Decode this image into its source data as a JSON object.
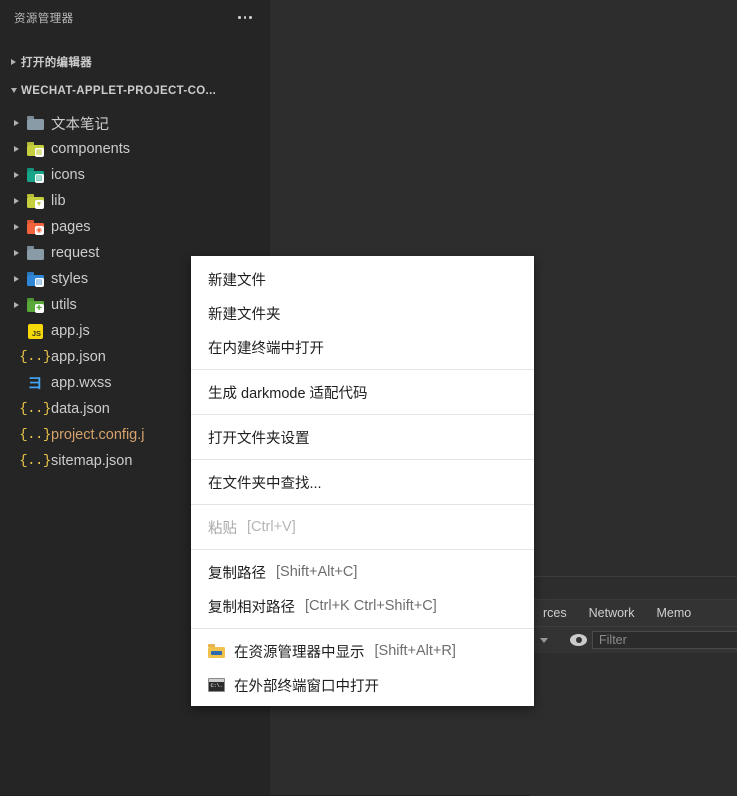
{
  "colors": {
    "sidebar_bg": "#252526",
    "editor_bg": "#2d2d2d",
    "menu_bg": "#ffffff",
    "text": "#cccccc",
    "modified_file": "#d5a26a"
  },
  "sidebar": {
    "title": "资源管理器",
    "more_label": "...",
    "sections": [
      {
        "label": "打开的编辑器",
        "expanded": false
      },
      {
        "label": "WECHAT-APPLET-PROJECT-CO...",
        "expanded": true
      }
    ],
    "tree": [
      {
        "label": "文本笔记",
        "type": "folder",
        "icon": "folder-gray-icon",
        "color": "#8a9ba8",
        "tabcolor": "#7a8a96",
        "glyph": "",
        "glyphbg": "",
        "expandable": true,
        "modified": false
      },
      {
        "label": "components",
        "type": "folder",
        "icon": "folder-components-icon",
        "color": "#c6cf3e",
        "tabcolor": "#b4bc38",
        "glyph": "▦",
        "glyphbg": "#ffffff",
        "expandable": true,
        "modified": false
      },
      {
        "label": "icons",
        "type": "folder",
        "icon": "folder-images-icon",
        "color": "#17a589",
        "tabcolor": "#13907a",
        "glyph": "▧",
        "glyphbg": "#ffffff",
        "expandable": true,
        "modified": false
      },
      {
        "label": "lib",
        "type": "folder",
        "icon": "folder-lib-icon",
        "color": "#c6cf3e",
        "tabcolor": "#b4bc38",
        "glyph": "▼",
        "glyphbg": "#ffffff",
        "expandable": true,
        "modified": false
      },
      {
        "label": "pages",
        "type": "folder",
        "icon": "folder-pages-icon",
        "color": "#f2643d",
        "tabcolor": "#dd5632",
        "glyph": "◉",
        "glyphbg": "#ffffff",
        "expandable": true,
        "modified": false
      },
      {
        "label": "request",
        "type": "folder",
        "icon": "folder-gray-icon",
        "color": "#8a9ba8",
        "tabcolor": "#7a8a96",
        "glyph": "",
        "glyphbg": "",
        "expandable": true,
        "modified": false
      },
      {
        "label": "styles",
        "type": "folder",
        "icon": "folder-css-icon",
        "color": "#2f86d6",
        "tabcolor": "#2a78c0",
        "glyph": "▤",
        "glyphbg": "#ffffff",
        "expandable": true,
        "modified": false
      },
      {
        "label": "utils",
        "type": "folder",
        "icon": "folder-tools-icon",
        "color": "#5aa83a",
        "tabcolor": "#4e9531",
        "glyph": "✚",
        "glyphbg": "#ffffff",
        "expandable": true,
        "modified": false
      },
      {
        "label": "app.js",
        "type": "file",
        "icon": "javascript-file-icon",
        "expandable": false,
        "modified": false
      },
      {
        "label": "app.json",
        "type": "file",
        "icon": "json-file-icon",
        "expandable": false,
        "modified": false
      },
      {
        "label": "app.wxss",
        "type": "file",
        "icon": "wxss-file-icon",
        "expandable": false,
        "modified": false
      },
      {
        "label": "data.json",
        "type": "file",
        "icon": "json-file-icon",
        "expandable": false,
        "modified": false
      },
      {
        "label": "project.config.j",
        "type": "file",
        "icon": "json-file-icon",
        "expandable": false,
        "modified": true
      },
      {
        "label": "sitemap.json",
        "type": "file",
        "icon": "json-file-icon",
        "expandable": false,
        "modified": false
      }
    ]
  },
  "context_menu": {
    "groups": [
      {
        "items": [
          {
            "label": "新建文件",
            "shortcut": "",
            "disabled": false,
            "icon": ""
          },
          {
            "label": "新建文件夹",
            "shortcut": "",
            "disabled": false,
            "icon": ""
          },
          {
            "label": "在内建终端中打开",
            "shortcut": "",
            "disabled": false,
            "icon": ""
          }
        ]
      },
      {
        "items": [
          {
            "label": "生成 darkmode 适配代码",
            "shortcut": "",
            "disabled": false,
            "icon": ""
          }
        ]
      },
      {
        "items": [
          {
            "label": "打开文件夹设置",
            "shortcut": "",
            "disabled": false,
            "icon": ""
          }
        ]
      },
      {
        "items": [
          {
            "label": "在文件夹中查找...",
            "shortcut": "",
            "disabled": false,
            "icon": ""
          }
        ]
      },
      {
        "items": [
          {
            "label": "粘贴",
            "shortcut": "[Ctrl+V]",
            "disabled": true,
            "icon": ""
          }
        ]
      },
      {
        "items": [
          {
            "label": "复制路径",
            "shortcut": "[Shift+Alt+C]",
            "disabled": false,
            "icon": ""
          },
          {
            "label": "复制相对路径",
            "shortcut": "[Ctrl+K Ctrl+Shift+C]",
            "disabled": false,
            "icon": ""
          }
        ]
      },
      {
        "items": [
          {
            "label": "在资源管理器中显示",
            "shortcut": "[Shift+Alt+R]",
            "disabled": false,
            "icon": "explorer-folder-icon"
          },
          {
            "label": "在外部终端窗口中打开",
            "shortcut": "",
            "disabled": false,
            "icon": "terminal-icon"
          }
        ]
      }
    ]
  },
  "devtools": {
    "tabs": [
      {
        "label": "rces",
        "active": false
      },
      {
        "label": "Network",
        "active": false
      },
      {
        "label": "Memo",
        "active": false
      }
    ],
    "toolbar": {
      "caret_icon": "chevron-down-icon",
      "eye_icon": "eye-icon",
      "filter_placeholder": "Filter",
      "filter_value": ""
    }
  }
}
